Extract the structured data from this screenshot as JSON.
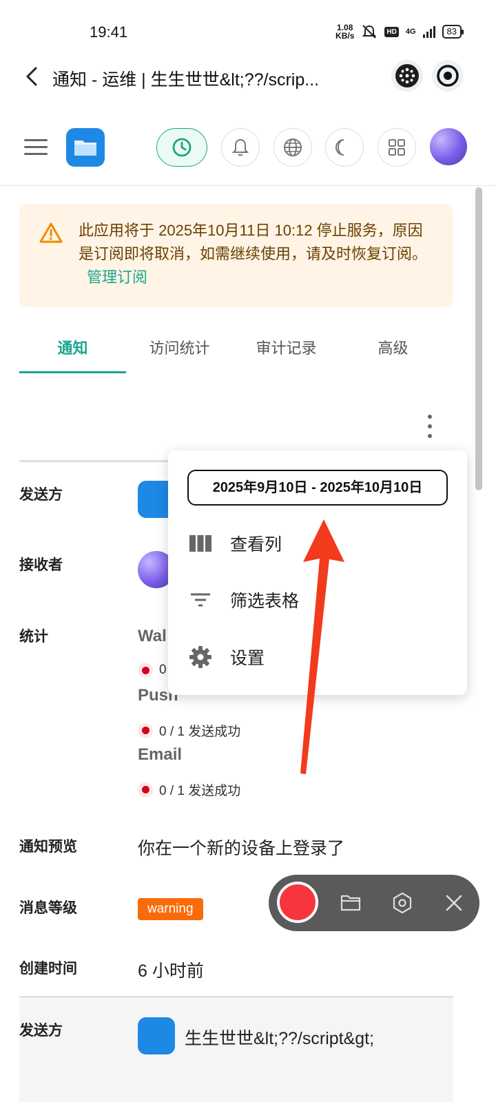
{
  "status": {
    "time": "19:41",
    "speed_value": "1.08",
    "speed_unit": "KB/s",
    "hd": "HD",
    "network": "4G",
    "battery": "83"
  },
  "titlebar": {
    "title": "通知 - 运维 | 生生世世&lt;??/scrip..."
  },
  "alert": {
    "text": "此应用将于 2025年10月11日 10:12 停止服务，原因是订阅即将取消，如需继续使用，请及时恢复订阅。",
    "link": "管理订阅"
  },
  "tabs": [
    "通知",
    "访问统计",
    "审计记录",
    "高级"
  ],
  "menu": {
    "date_range": "2025年9月10日 - 2025年10月10日",
    "items": [
      "查看列",
      "筛选表格",
      "设置"
    ]
  },
  "details": {
    "sender_label": "发送方",
    "receiver_label": "接收者",
    "stats_label": "统计",
    "channels": [
      {
        "name": "Wal",
        "stat": "0"
      },
      {
        "name": "Push",
        "stat": "0 / 1 发送成功"
      },
      {
        "name": "Email",
        "stat": "0 / 1 发送成功"
      }
    ],
    "preview_label": "通知预览",
    "preview_value": "你在一个新的设备上登录了",
    "level_label": "消息等级",
    "level_value": "warning",
    "created_label": "创建时间",
    "created_value": "6 小时前",
    "sender2_label": "发送方",
    "sender2_value": "生生世世&lt;??/script&gt;"
  },
  "colors": {
    "accent": "#19a58f",
    "alert_bg": "#fff4e5",
    "warning_badge": "#f96b08",
    "error_dot": "#d0021b",
    "record": "#f7353f"
  }
}
